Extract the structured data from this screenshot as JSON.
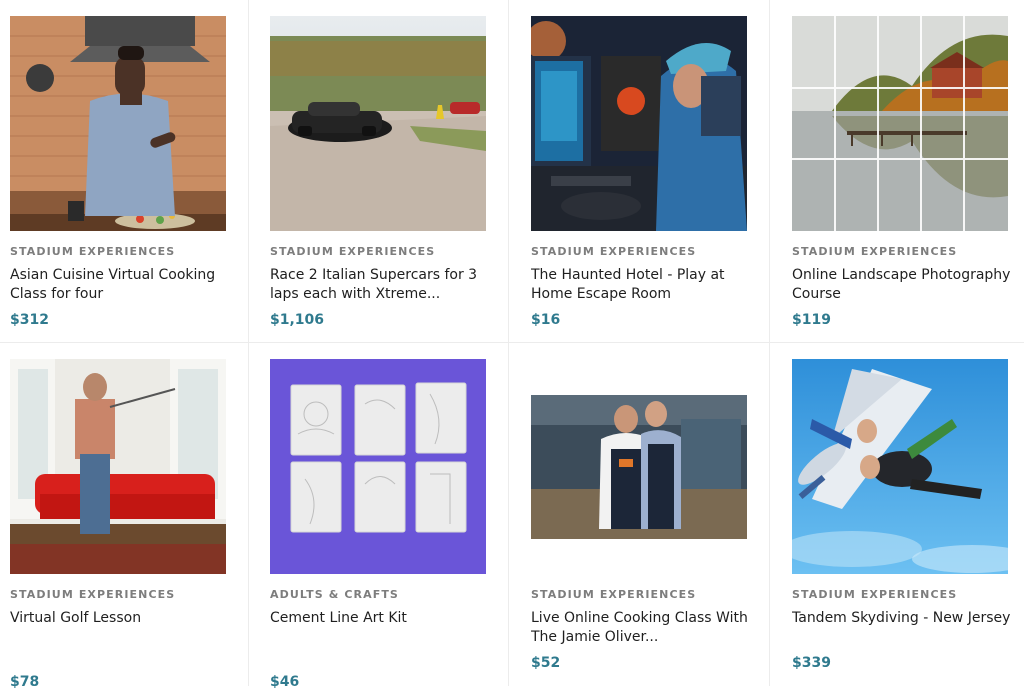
{
  "products": [
    {
      "category": "STADIUM EXPERIENCES",
      "title": "Asian Cuisine Virtual Cooking Class for four",
      "price": "$312",
      "image": "man-cooking-in-kitchen-photo"
    },
    {
      "category": "STADIUM EXPERIENCES",
      "title": "Race 2 Italian Supercars for 3 laps each with Xtreme...",
      "price": "$1,106",
      "image": "supercar-on-racetrack-photo"
    },
    {
      "category": "STADIUM EXPERIENCES",
      "title": "The Haunted Hotel - Play at Home Escape Room",
      "price": "$16",
      "image": "gamer-at-computer-photo"
    },
    {
      "category": "STADIUM EXPERIENCES",
      "title": "Online Landscape Photography Course",
      "price": "$119",
      "image": "lake-boathouse-landscape-photo"
    },
    {
      "category": "STADIUM EXPERIENCES",
      "title": "Virtual Golf Lesson",
      "price": "$78",
      "image": "man-golf-swing-living-room-photo"
    },
    {
      "category": "ADULTS & CRAFTS",
      "title": "Cement Line Art Kit",
      "price": "$46",
      "image": "cement-tiles-on-purple-photo"
    },
    {
      "category": "STADIUM EXPERIENCES",
      "title": "Live Online Cooking Class With The Jamie Oliver...",
      "price": "$52",
      "image": "two-chefs-in-kitchen-photo"
    },
    {
      "category": "STADIUM EXPERIENCES",
      "title": "Tandem Skydiving - New Jersey",
      "price": "$339",
      "image": "tandem-skydivers-sky-photo"
    }
  ],
  "colors": {
    "price": "#2f7a8e",
    "category": "#7d7d7d",
    "divider": "#ececec"
  }
}
